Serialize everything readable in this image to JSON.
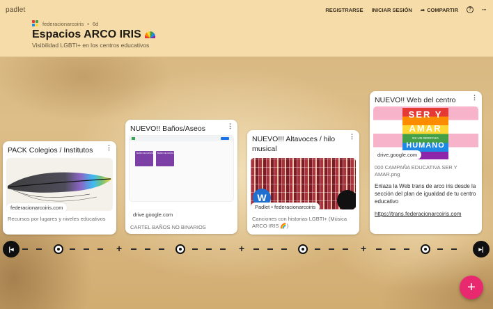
{
  "header": {
    "brand": "padlet",
    "register_label": "REGISTRARSE",
    "login_label": "INICIAR SESIÓN",
    "share_label": "COMPARTIR",
    "help_glyph": "?",
    "more_glyph": "···",
    "author": "federacionarcoiris",
    "age": "6d",
    "title": "Espacios ARCO IRIS",
    "subtitle": "Visibilidad LGBTI+ en los centros educativos"
  },
  "colors": {
    "header_bg": "#f6dca8",
    "fab": "#e8296f",
    "card_bg": "#ffffff"
  },
  "cards": [
    {
      "title": "PACK Colegios / Institutos",
      "source": "federacionarcoiris.com",
      "caption": "Recursos por lugares y niveles educativos"
    },
    {
      "title": "NUEVO!! Baños/Aseos",
      "source": "drive.google.com",
      "caption": "CARTEL BAÑOS NO BINARIOS",
      "doc_labels": [
        "BAÑO DE NIÑOS",
        "BAÑO DE NIÑAS"
      ]
    },
    {
      "title": "NUEVO!!! Altavoces / hilo musical",
      "source": "Padlet • federacionarcoiris",
      "caption": "Canciones con historias LGBTI+ (Música ARCO IRIS 🌈)"
    },
    {
      "title": "NUEVO!! Web del centro",
      "source": "drive.google.com",
      "caption": "000 CAMPAÑA EDUCATIVA SER Y AMAR.png",
      "body": "Enlaza la Web trans de arco iris desde la sección del plan de igualdad de tu centro educativo",
      "link": "https://trans.federacionarcoiris.com",
      "poster_lines": [
        "SER Y",
        "AMAR",
        "ES UN DERECHO",
        "HUMANO"
      ]
    }
  ],
  "timeline": {
    "prev_glyph": "|◂",
    "next_glyph": "▸|",
    "add_glyph": "+"
  },
  "fab_glyph": "+"
}
